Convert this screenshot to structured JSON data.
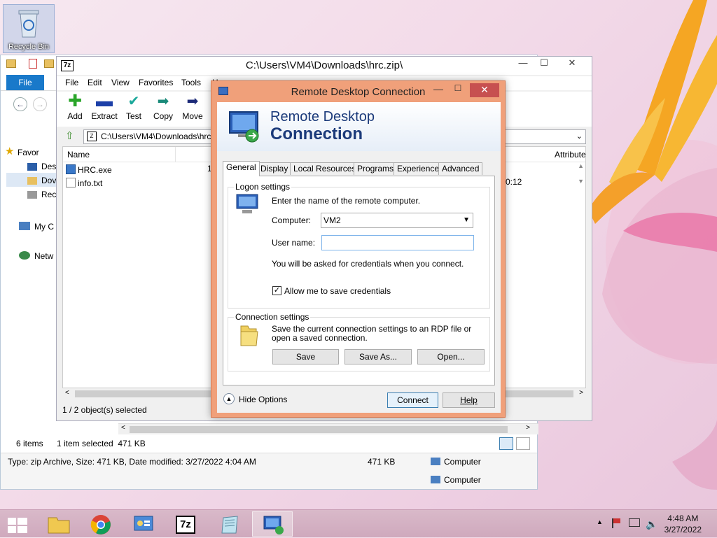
{
  "desktop": {
    "recycle_bin_label": "Recycle Bin"
  },
  "explorer": {
    "file_tab": "File",
    "nav_items": [
      "Favor",
      "Des",
      "Dov",
      "Rec",
      "My C",
      "Netw"
    ],
    "status_items": "6 items",
    "status_selected": "1 item selected  471 KB",
    "details_type": "Type: zip Archive, Size: 471 KB, Date modified: 3/27/2022 4:04 AM",
    "details_size": "471 KB",
    "details_location_1": "Computer",
    "details_location_2": "Computer"
  },
  "sevenzip": {
    "title": "C:\\Users\\VM4\\Downloads\\hrc.zip\\",
    "logo_text": "7z",
    "menu": [
      "File",
      "Edit",
      "View",
      "Favorites",
      "Tools",
      "H"
    ],
    "tools": [
      "Add",
      "Extract",
      "Test",
      "Copy",
      "Move"
    ],
    "address": "C:\\Users\\VM4\\Downloads\\hrc",
    "columns": {
      "name": "Name",
      "attributes": "Attribute"
    },
    "files": [
      {
        "name": "HRC.exe",
        "col2": "1",
        "modified": ""
      },
      {
        "name": "info.txt",
        "col2": "",
        "modified": "0:12"
      }
    ],
    "status": "1 / 2 object(s) selected"
  },
  "rdp": {
    "title": "Remote Desktop Connection",
    "banner_line1": "Remote Desktop",
    "banner_line2": "Connection",
    "tabs": [
      "General",
      "Display",
      "Local Resources",
      "Programs",
      "Experience",
      "Advanced"
    ],
    "logon_group": "Logon settings",
    "logon_instruction": "Enter the name of the remote computer.",
    "computer_label": "Computer:",
    "computer_value": "VM2",
    "username_label": "User name:",
    "username_value": "",
    "credentials_note": "You will be asked for credentials when you connect.",
    "allow_save_label": "Allow me to save credentials",
    "allow_save_checked": true,
    "connection_group": "Connection settings",
    "connection_text": "Save the current connection settings to an RDP file or open a saved connection.",
    "save_button": "Save",
    "save_as_button": "Save As...",
    "open_button": "Open...",
    "hide_options": "Hide Options",
    "connect_button": "Connect",
    "help_button": "Help"
  },
  "taskbar": {
    "time": "4:48 AM",
    "date": "3/27/2022",
    "sevenzip_label": "7z"
  }
}
